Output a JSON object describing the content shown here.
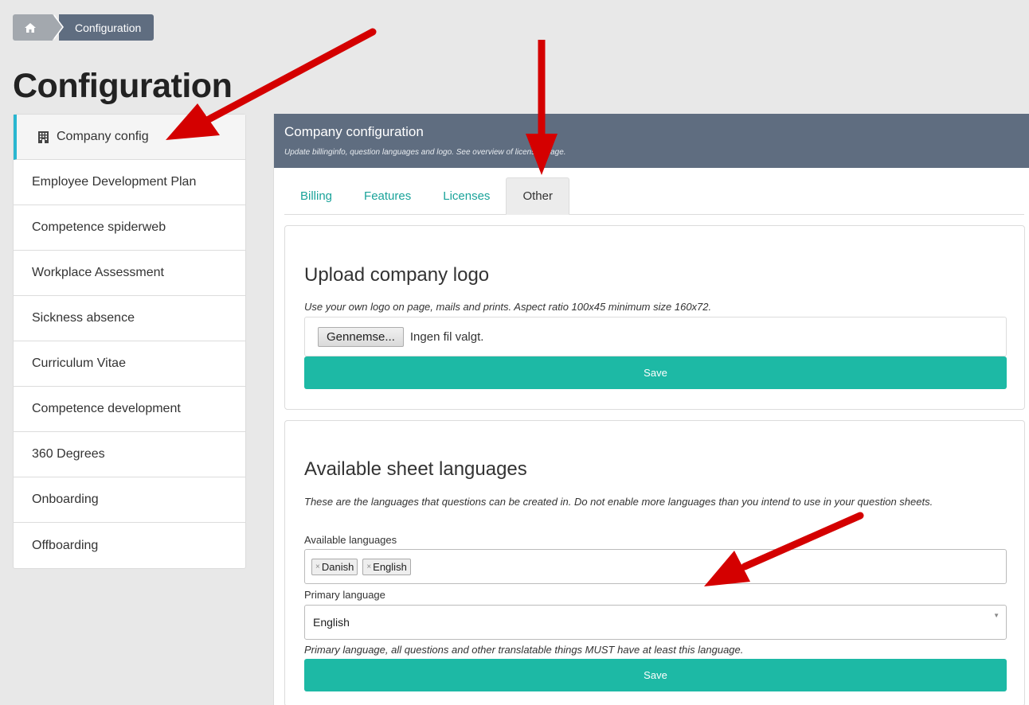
{
  "breadcrumb": {
    "home_icon": "home-icon",
    "current": "Configuration"
  },
  "page_title": "Configuration",
  "sidebar": {
    "items": [
      {
        "label": "Company config",
        "icon": "building-icon",
        "active": true
      },
      {
        "label": "Employee Development Plan"
      },
      {
        "label": "Competence spiderweb"
      },
      {
        "label": "Workplace Assessment"
      },
      {
        "label": "Sickness absence"
      },
      {
        "label": "Curriculum Vitae"
      },
      {
        "label": "Competence development"
      },
      {
        "label": "360 Degrees"
      },
      {
        "label": "Onboarding"
      },
      {
        "label": "Offboarding"
      }
    ]
  },
  "panel": {
    "title": "Company configuration",
    "subtitle": "Update billinginfo, question languages and logo. See overview of license usage.",
    "tabs": [
      {
        "label": "Billing"
      },
      {
        "label": "Features"
      },
      {
        "label": "Licenses"
      },
      {
        "label": "Other",
        "active": true
      }
    ]
  },
  "logo_card": {
    "title": "Upload company logo",
    "description": "Use your own logo on page, mails and prints. Aspect ratio 100x45 minimum size 160x72.",
    "browse_label": "Gennemse...",
    "file_status": "Ingen fil valgt.",
    "save_label": "Save"
  },
  "lang_card": {
    "title": "Available sheet languages",
    "description": "These are the languages that questions can be created in. Do not enable more languages than you intend to use in your question sheets.",
    "available_label": "Available languages",
    "tags": [
      {
        "label": "Danish"
      },
      {
        "label": "English"
      }
    ],
    "tag_remove": "×",
    "primary_label": "Primary language",
    "primary_value": "English",
    "primary_note": "Primary language, all questions and other translatable things MUST have at least this language.",
    "save_label": "Save"
  },
  "colors": {
    "accent": "#1db9a5",
    "header": "#5f6d80",
    "active_bar": "#29b6d0",
    "annotation_arrow": "#d40000"
  }
}
